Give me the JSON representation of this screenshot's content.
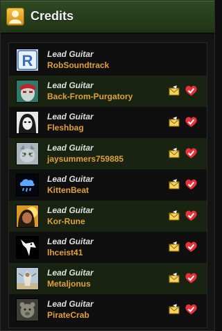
{
  "header": {
    "title": "Credits"
  },
  "colors": {
    "header_green": "#2f4a22",
    "name_orange": "#e0a13a",
    "row_alt": "#182312"
  },
  "credits": [
    {
      "role": "Lead Guitar",
      "name": "RobSoundtrack",
      "avatar": "letter-r-logo",
      "has_actions": false
    },
    {
      "role": "Lead Guitar",
      "name": "Back-From-Purgatory",
      "avatar": "red-masked-face",
      "has_actions": true
    },
    {
      "role": "Lead Guitar",
      "name": "Fleshbag",
      "avatar": "hooded-mask",
      "has_actions": true
    },
    {
      "role": "Lead Guitar",
      "name": "jaysummers759885",
      "avatar": "cat-face",
      "has_actions": true
    },
    {
      "role": "Lead Guitar",
      "name": "KittenBeat",
      "avatar": "blue-rain-cloud",
      "has_actions": true
    },
    {
      "role": "Lead Guitar",
      "name": "Kor-Rune",
      "avatar": "person-yellow-light",
      "has_actions": true
    },
    {
      "role": "Lead Guitar",
      "name": "lhceist41",
      "avatar": "white-bird-logo",
      "has_actions": true
    },
    {
      "role": "Lead Guitar",
      "name": "Metaljonus",
      "avatar": "sky-figure",
      "has_actions": true
    },
    {
      "role": "Lead Guitar",
      "name": "PirateCrab",
      "avatar": "bear-statue",
      "has_actions": true
    }
  ]
}
